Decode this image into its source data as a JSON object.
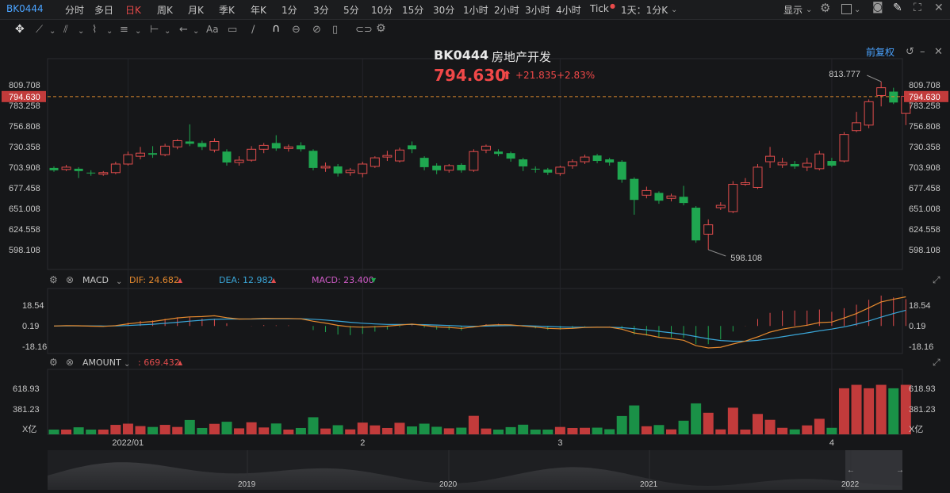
{
  "toolbar": {
    "symbol": "BK0444",
    "periods": [
      "分时",
      "多日",
      "日K",
      "周K",
      "月K",
      "季K",
      "年K",
      "1分",
      "3分",
      "5分",
      "10分",
      "15分",
      "30分",
      "1小时",
      "2小时",
      "3小时",
      "4小时",
      "Tick"
    ],
    "active_period": "日K",
    "interval_select": "1天：1分K",
    "display_label": "显示"
  },
  "header": {
    "code": "BK0444",
    "name": "房地产开发",
    "price": "794.630",
    "change": "+21.835",
    "change_pct": "+2.83%",
    "adjust_label": "前复权"
  },
  "colors": {
    "up": "#e04c4c",
    "down": "#1fa750",
    "up_bar": "#c23b3b",
    "down_bar": "#1a9147",
    "dif": "#e68a2e",
    "dea": "#3aa6d8",
    "macd_text": "#d05cc8"
  },
  "chart_data": [
    {
      "type": "candlestick",
      "y_ticks": [
        "809.708",
        "783.258",
        "756.808",
        "730.358",
        "703.908",
        "677.458",
        "651.008",
        "624.558",
        "598.108"
      ],
      "ylim": [
        582,
        830
      ],
      "current_price_label": "794.630",
      "high_annotation": "813.777",
      "low_annotation": "598.108",
      "x_labels": [
        "2022/01",
        "2",
        "3",
        "4"
      ],
      "candles": [
        {
          "o": 703,
          "c": 700,
          "h": 705,
          "l": 698
        },
        {
          "o": 701,
          "c": 704,
          "h": 707,
          "l": 699
        },
        {
          "o": 702,
          "c": 699,
          "h": 704,
          "l": 690
        },
        {
          "o": 697,
          "c": 696,
          "h": 700,
          "l": 693
        },
        {
          "o": 695,
          "c": 697,
          "h": 699,
          "l": 693
        },
        {
          "o": 697,
          "c": 708,
          "h": 711,
          "l": 695
        },
        {
          "o": 708,
          "c": 720,
          "h": 724,
          "l": 706
        },
        {
          "o": 718,
          "c": 722,
          "h": 730,
          "l": 714
        },
        {
          "o": 722,
          "c": 720,
          "h": 731,
          "l": 716
        },
        {
          "o": 720,
          "c": 731,
          "h": 734,
          "l": 718
        },
        {
          "o": 730,
          "c": 738,
          "h": 740,
          "l": 727
        },
        {
          "o": 737,
          "c": 734,
          "h": 759,
          "l": 731
        },
        {
          "o": 735,
          "c": 730,
          "h": 738,
          "l": 726
        },
        {
          "o": 726,
          "c": 737,
          "h": 741,
          "l": 723
        },
        {
          "o": 724,
          "c": 710,
          "h": 727,
          "l": 706
        },
        {
          "o": 710,
          "c": 713,
          "h": 718,
          "l": 706
        },
        {
          "o": 713,
          "c": 727,
          "h": 731,
          "l": 711
        },
        {
          "o": 727,
          "c": 732,
          "h": 735,
          "l": 722
        },
        {
          "o": 735,
          "c": 728,
          "h": 745,
          "l": 725
        },
        {
          "o": 728,
          "c": 730,
          "h": 733,
          "l": 724
        },
        {
          "o": 732,
          "c": 727,
          "h": 736,
          "l": 724
        },
        {
          "o": 725,
          "c": 703,
          "h": 727,
          "l": 700
        },
        {
          "o": 703,
          "c": 705,
          "h": 710,
          "l": 698
        },
        {
          "o": 705,
          "c": 696,
          "h": 708,
          "l": 692
        },
        {
          "o": 697,
          "c": 700,
          "h": 703,
          "l": 693
        },
        {
          "o": 696,
          "c": 708,
          "h": 711,
          "l": 691
        },
        {
          "o": 705,
          "c": 716,
          "h": 718,
          "l": 703
        },
        {
          "o": 717,
          "c": 719,
          "h": 725,
          "l": 712
        },
        {
          "o": 712,
          "c": 726,
          "h": 729,
          "l": 710
        },
        {
          "o": 732,
          "c": 727,
          "h": 737,
          "l": 722
        },
        {
          "o": 716,
          "c": 704,
          "h": 718,
          "l": 700
        },
        {
          "o": 706,
          "c": 700,
          "h": 709,
          "l": 695
        },
        {
          "o": 700,
          "c": 706,
          "h": 708,
          "l": 697
        },
        {
          "o": 707,
          "c": 700,
          "h": 709,
          "l": 697
        },
        {
          "o": 700,
          "c": 724,
          "h": 727,
          "l": 698
        },
        {
          "o": 726,
          "c": 731,
          "h": 733,
          "l": 722
        },
        {
          "o": 724,
          "c": 721,
          "h": 727,
          "l": 718
        },
        {
          "o": 722,
          "c": 715,
          "h": 724,
          "l": 711
        },
        {
          "o": 714,
          "c": 705,
          "h": 716,
          "l": 699
        },
        {
          "o": 702,
          "c": 701,
          "h": 705,
          "l": 697
        },
        {
          "o": 701,
          "c": 697,
          "h": 703,
          "l": 694
        },
        {
          "o": 696,
          "c": 704,
          "h": 706,
          "l": 693
        },
        {
          "o": 706,
          "c": 711,
          "h": 714,
          "l": 702
        },
        {
          "o": 711,
          "c": 717,
          "h": 720,
          "l": 708
        },
        {
          "o": 719,
          "c": 712,
          "h": 721,
          "l": 709
        },
        {
          "o": 714,
          "c": 710,
          "h": 716,
          "l": 706
        },
        {
          "o": 711,
          "c": 688,
          "h": 713,
          "l": 684
        },
        {
          "o": 689,
          "c": 662,
          "h": 691,
          "l": 643
        },
        {
          "o": 668,
          "c": 674,
          "h": 679,
          "l": 664
        },
        {
          "o": 671,
          "c": 661,
          "h": 673,
          "l": 657
        },
        {
          "o": 664,
          "c": 667,
          "h": 670,
          "l": 660
        },
        {
          "o": 666,
          "c": 658,
          "h": 680,
          "l": 655
        },
        {
          "o": 652,
          "c": 610,
          "h": 654,
          "l": 607
        },
        {
          "o": 618,
          "c": 630,
          "h": 637,
          "l": 598.108
        },
        {
          "o": 652,
          "c": 655,
          "h": 659,
          "l": 649
        },
        {
          "o": 647,
          "c": 682,
          "h": 686,
          "l": 645
        },
        {
          "o": 682,
          "c": 684,
          "h": 690,
          "l": 680
        },
        {
          "o": 678,
          "c": 704,
          "h": 708,
          "l": 676
        },
        {
          "o": 711,
          "c": 718,
          "h": 730,
          "l": 703
        },
        {
          "o": 707,
          "c": 710,
          "h": 716,
          "l": 703
        },
        {
          "o": 708,
          "c": 705,
          "h": 712,
          "l": 702
        },
        {
          "o": 704,
          "c": 709,
          "h": 716,
          "l": 699
        },
        {
          "o": 702,
          "c": 721,
          "h": 725,
          "l": 700
        },
        {
          "o": 712,
          "c": 706,
          "h": 716,
          "l": 704
        },
        {
          "o": 712,
          "c": 746,
          "h": 749,
          "l": 710
        },
        {
          "o": 751,
          "c": 761,
          "h": 775,
          "l": 749
        },
        {
          "o": 758,
          "c": 788,
          "h": 791,
          "l": 754
        },
        {
          "o": 796,
          "c": 806,
          "h": 813.777,
          "l": 782
        },
        {
          "o": 801,
          "c": 787,
          "h": 806,
          "l": 785
        },
        {
          "o": 773,
          "c": 795,
          "h": 802,
          "l": 758
        }
      ]
    },
    {
      "type": "line",
      "name": "MACD",
      "indicator_label": "MACD",
      "dif_label": "DIF: 24.682",
      "dea_label": "DEA: 12.982",
      "macd_label": "MACD: 23.400",
      "y_ticks": [
        "18.54",
        "0.19",
        "-18.16"
      ],
      "ylim": [
        -18.16,
        18.54
      ]
    },
    {
      "type": "bar",
      "name": "AMOUNT",
      "indicator_label": "AMOUNT",
      "value_label": ": 669.432",
      "y_ticks": [
        "618.93",
        "381.23"
      ],
      "unit_label": "X亿"
    }
  ],
  "navigator": {
    "years": [
      "2019",
      "2020",
      "2021",
      "2022"
    ]
  }
}
